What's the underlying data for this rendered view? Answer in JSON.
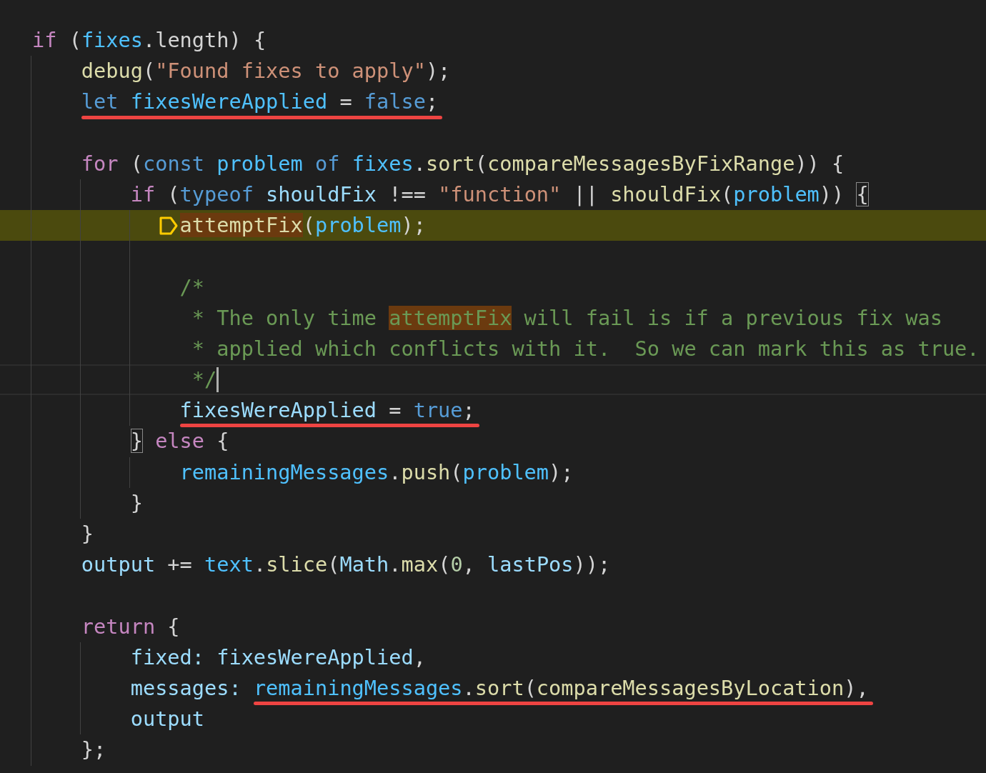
{
  "editor": {
    "lines": [
      {
        "kind": "code",
        "paused": false,
        "cursor": false,
        "tokens": [
          {
            "text": "if",
            "kind": "keyword"
          },
          {
            "text": " (",
            "kind": "plain"
          },
          {
            "text": "fixes",
            "kind": "constant"
          },
          {
            "text": ".length) {",
            "kind": "plain"
          }
        ],
        "children": [
          {
            "kind": "code",
            "paused": false,
            "cursor": false,
            "tokens": [
              {
                "text": "debug",
                "kind": "function"
              },
              {
                "text": "(",
                "kind": "plain"
              },
              {
                "text": "\"Found fixes to apply\"",
                "kind": "string"
              },
              {
                "text": ");",
                "kind": "plain"
              }
            ]
          },
          {
            "kind": "code",
            "paused": false,
            "cursor": false,
            "tokens": [
              {
                "text": "let ",
                "kind": "storage",
                "underlined": true
              },
              {
                "text": "fixesWereApplied",
                "kind": "constant",
                "underlined": true
              },
              {
                "text": " = ",
                "kind": "plain",
                "underlined": true
              },
              {
                "text": "false",
                "kind": "storage",
                "underlined": true
              },
              {
                "text": ";",
                "kind": "plain",
                "underlined": true
              }
            ]
          },
          {
            "kind": "blank"
          },
          {
            "kind": "code",
            "paused": false,
            "cursor": false,
            "tokens": [
              {
                "text": "for",
                "kind": "keyword"
              },
              {
                "text": " (",
                "kind": "plain"
              },
              {
                "text": "const",
                "kind": "storage"
              },
              {
                "text": " problem",
                "kind": "constant"
              },
              {
                "text": " of",
                "kind": "storage"
              },
              {
                "text": " fixes",
                "kind": "constant"
              },
              {
                "text": ".",
                "kind": "plain"
              },
              {
                "text": "sort",
                "kind": "function"
              },
              {
                "text": "(",
                "kind": "plain"
              },
              {
                "text": "compareMessagesByFixRange",
                "kind": "function"
              },
              {
                "text": ")) {",
                "kind": "plain"
              }
            ],
            "children": [
              {
                "kind": "code",
                "paused": false,
                "cursor": false,
                "tokens": [
                  {
                    "text": "if",
                    "kind": "keyword"
                  },
                  {
                    "text": " (",
                    "kind": "plain"
                  },
                  {
                    "text": "typeof",
                    "kind": "storage"
                  },
                  {
                    "text": " shouldFix",
                    "kind": "variable"
                  },
                  {
                    "text": " !== ",
                    "kind": "plain"
                  },
                  {
                    "text": "\"function\"",
                    "kind": "string"
                  },
                  {
                    "text": " || ",
                    "kind": "plain"
                  },
                  {
                    "text": "shouldFix",
                    "kind": "function"
                  },
                  {
                    "text": "(",
                    "kind": "plain"
                  },
                  {
                    "text": "problem",
                    "kind": "constant"
                  },
                  {
                    "text": ")) ",
                    "kind": "plain"
                  },
                  {
                    "text": "{",
                    "kind": "plain",
                    "matched": true
                  }
                ],
                "children": [
                  {
                    "kind": "code",
                    "paused": true,
                    "cursor": false,
                    "tokens": [
                      {
                        "text": "attemptFix",
                        "kind": "function",
                        "highlight": true
                      },
                      {
                        "text": "(",
                        "kind": "plain"
                      },
                      {
                        "text": "problem",
                        "kind": "constant"
                      },
                      {
                        "text": ");",
                        "kind": "plain"
                      }
                    ]
                  },
                  {
                    "kind": "blank"
                  },
                  {
                    "kind": "code",
                    "paused": false,
                    "cursor": false,
                    "tokens": [
                      {
                        "text": "/*",
                        "kind": "comment"
                      }
                    ]
                  },
                  {
                    "kind": "code",
                    "paused": false,
                    "cursor": false,
                    "tokens": [
                      {
                        "text": " * The only time ",
                        "kind": "comment"
                      },
                      {
                        "text": "attemptFix",
                        "kind": "comment",
                        "highlight": true
                      },
                      {
                        "text": " will fail is if a previous fix was",
                        "kind": "comment"
                      }
                    ]
                  },
                  {
                    "kind": "code",
                    "paused": false,
                    "cursor": false,
                    "tokens": [
                      {
                        "text": " * applied which conflicts with it.  So we can mark this as true.",
                        "kind": "comment"
                      }
                    ]
                  },
                  {
                    "kind": "code",
                    "paused": false,
                    "cursor": true,
                    "tokens": [
                      {
                        "text": " */",
                        "kind": "comment"
                      }
                    ]
                  },
                  {
                    "kind": "code",
                    "paused": false,
                    "cursor": false,
                    "tokens": [
                      {
                        "text": "fixesWereApplied",
                        "kind": "variable",
                        "underlined": true
                      },
                      {
                        "text": " = ",
                        "kind": "plain",
                        "underlined": true
                      },
                      {
                        "text": "true",
                        "kind": "storage",
                        "underlined": true
                      },
                      {
                        "text": ";",
                        "kind": "plain",
                        "underlined": true
                      }
                    ]
                  }
                ]
              },
              {
                "kind": "code",
                "paused": false,
                "cursor": false,
                "tokens": [
                  {
                    "text": "}",
                    "kind": "plain",
                    "matched": true
                  },
                  {
                    "text": " else",
                    "kind": "keyword"
                  },
                  {
                    "text": " {",
                    "kind": "plain"
                  }
                ],
                "children": [
                  {
                    "kind": "code",
                    "paused": false,
                    "cursor": false,
                    "tokens": [
                      {
                        "text": "remainingMessages",
                        "kind": "constant"
                      },
                      {
                        "text": ".",
                        "kind": "plain"
                      },
                      {
                        "text": "push",
                        "kind": "function"
                      },
                      {
                        "text": "(",
                        "kind": "plain"
                      },
                      {
                        "text": "problem",
                        "kind": "constant"
                      },
                      {
                        "text": ");",
                        "kind": "plain"
                      }
                    ]
                  }
                ]
              },
              {
                "kind": "code",
                "paused": false,
                "cursor": false,
                "tokens": [
                  {
                    "text": "}",
                    "kind": "plain"
                  }
                ]
              }
            ]
          },
          {
            "kind": "code",
            "paused": false,
            "cursor": false,
            "tokens": [
              {
                "text": "}",
                "kind": "plain"
              }
            ]
          },
          {
            "kind": "code",
            "paused": false,
            "cursor": false,
            "tokens": [
              {
                "text": "output",
                "kind": "variable"
              },
              {
                "text": " += ",
                "kind": "plain"
              },
              {
                "text": "text",
                "kind": "constant"
              },
              {
                "text": ".",
                "kind": "plain"
              },
              {
                "text": "slice",
                "kind": "function"
              },
              {
                "text": "(",
                "kind": "plain"
              },
              {
                "text": "Math",
                "kind": "variable"
              },
              {
                "text": ".",
                "kind": "plain"
              },
              {
                "text": "max",
                "kind": "function"
              },
              {
                "text": "(",
                "kind": "plain"
              },
              {
                "text": "0",
                "kind": "number"
              },
              {
                "text": ", ",
                "kind": "plain"
              },
              {
                "text": "lastPos",
                "kind": "variable"
              },
              {
                "text": "));",
                "kind": "plain"
              }
            ]
          },
          {
            "kind": "blank"
          },
          {
            "kind": "code",
            "paused": false,
            "cursor": false,
            "tokens": [
              {
                "text": "return",
                "kind": "keyword"
              },
              {
                "text": " {",
                "kind": "plain"
              }
            ],
            "children": [
              {
                "kind": "code",
                "paused": false,
                "cursor": false,
                "tokens": [
                  {
                    "text": "fixed: fixesWereApplied",
                    "kind": "variable"
                  },
                  {
                    "text": ",",
                    "kind": "plain"
                  }
                ]
              },
              {
                "kind": "code",
                "paused": false,
                "cursor": false,
                "tokens": [
                  {
                    "text": "messages: ",
                    "kind": "variable"
                  },
                  {
                    "text": "remainingMessages",
                    "kind": "constant",
                    "underlined": true
                  },
                  {
                    "text": ".",
                    "kind": "plain",
                    "underlined": true
                  },
                  {
                    "text": "sort",
                    "kind": "function",
                    "underlined": true
                  },
                  {
                    "text": "(",
                    "kind": "plain",
                    "underlined": true
                  },
                  {
                    "text": "compareMessagesByLocation",
                    "kind": "function",
                    "underlined": true
                  },
                  {
                    "text": "),",
                    "kind": "plain",
                    "underlined": true
                  }
                ]
              },
              {
                "kind": "code",
                "paused": false,
                "cursor": false,
                "tokens": [
                  {
                    "text": "output",
                    "kind": "variable"
                  }
                ]
              }
            ]
          },
          {
            "kind": "code",
            "paused": false,
            "cursor": false,
            "tokens": [
              {
                "text": "};",
                "kind": "plain"
              }
            ]
          }
        ]
      }
    ]
  }
}
